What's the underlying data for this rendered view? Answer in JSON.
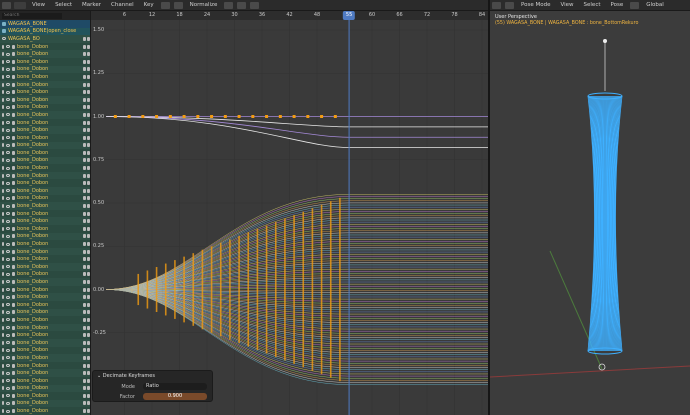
{
  "graph_editor": {
    "header": {
      "menus": [
        "View",
        "Select",
        "Marker",
        "Channel",
        "Key"
      ],
      "normalize_label": "Normalize"
    },
    "search": {
      "placeholder": "Search"
    },
    "channels": {
      "object": "WAGASA_BONE",
      "action": "WAGASA_BONE|open_close",
      "action_child": "WAGASA_BO",
      "bones": [
        "bone_Dobon",
        "bone_Dobon",
        "bone_Dobon",
        "bone_Dobon",
        "bone_Dobon",
        "bone_Dobon",
        "bone_Dobon",
        "bone_Dobon",
        "bone_Dobon",
        "bone_Dobon",
        "bone_Dobon",
        "bone_Dobon",
        "bone_Dobon",
        "bone_Dobon",
        "bone_Dobon",
        "bone_Dobon",
        "bone_Dobon",
        "bone_Dobon",
        "bone_Dobon",
        "bone_Dobon",
        "bone_Dobon",
        "bone_Dobon",
        "bone_Dobon",
        "bone_Dobon",
        "bone_Dobon",
        "bone_Dobon",
        "bone_Dobon",
        "bone_Dobon",
        "bone_Dobon",
        "bone_Dobon",
        "bone_Dobon",
        "bone_Dobon",
        "bone_Dobon",
        "bone_Dobon",
        "bone_Dobon",
        "bone_Dobon",
        "bone_Dobon",
        "bone_Dobon",
        "bone_Dobon",
        "bone_Dobon",
        "bone_Dobon",
        "bone_Dobon",
        "bone_Dobon",
        "bone_Dobon",
        "bone_Dobon",
        "bone_Dobon",
        "bone_Dobon",
        "bone_Dobon",
        "bone_Dobon",
        "bone_Dobon"
      ]
    },
    "frame_ticks": [
      "6",
      "12",
      "18",
      "24",
      "30",
      "36",
      "42",
      "48",
      "60",
      "66",
      "72",
      "78",
      "84"
    ],
    "value_ticks": [
      "1.50",
      "1.25",
      "1.00",
      "0.75",
      "0.50",
      "0.25",
      "0.00",
      "-0.25"
    ],
    "playhead_frame": "55",
    "decimate": {
      "title": "Decimate Keyframes",
      "mode_label": "Mode",
      "mode_value": "Ratio",
      "factor_label": "Factor",
      "factor_value": "0.900"
    }
  },
  "viewport": {
    "header": {
      "mode": "Pose Mode",
      "menus": [
        "View",
        "Select",
        "Pose"
      ],
      "orientation": "Global"
    },
    "perspective_label": "User Perspective",
    "object_label": "(55) WAGASA_BONE | WAGASA_BONE : bone_BottomRekuro"
  },
  "colors": {
    "accent": "#4f7bc3",
    "keyframe": "#f39c12",
    "bone_blue": "#3fb0ff",
    "channel_orange": "#e6c35a"
  }
}
